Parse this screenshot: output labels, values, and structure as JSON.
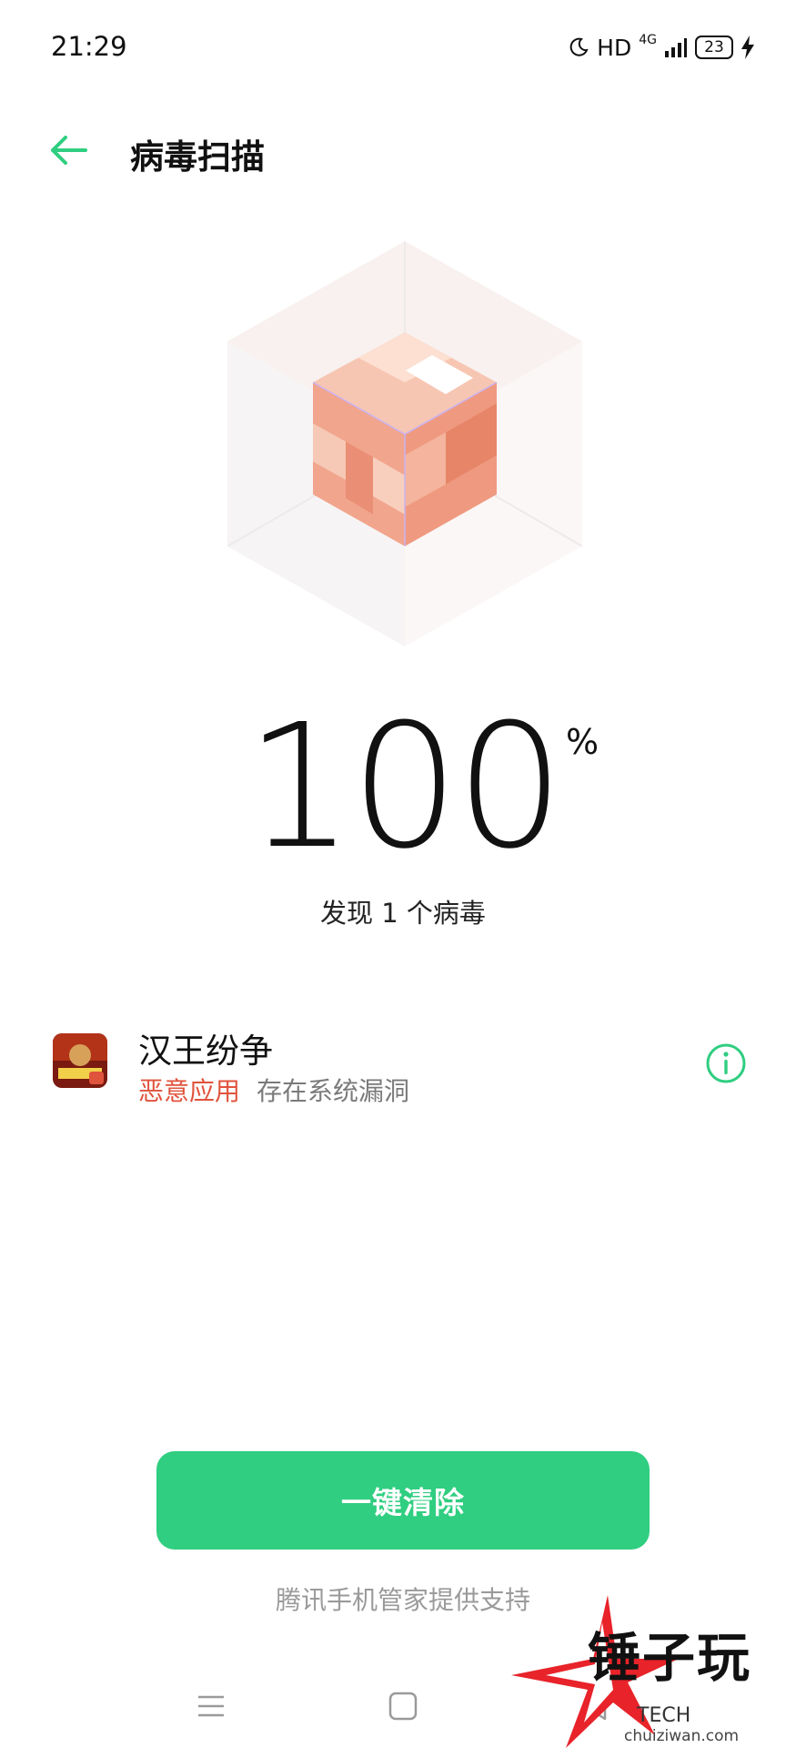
{
  "status_bar": {
    "time": "21:29",
    "hd": "HD",
    "network": "4G",
    "battery": "23"
  },
  "header": {
    "title": "病毒扫描"
  },
  "scan": {
    "percent": "100",
    "percent_sign": "%",
    "result_text": "发现 1 个病毒"
  },
  "threat": {
    "app_name": "汉王纷争",
    "threat_type": "恶意应用",
    "threat_desc": "存在系统漏洞"
  },
  "actions": {
    "clean_label": "一键清除"
  },
  "footer": {
    "support_text": "腾讯手机管家提供支持"
  },
  "watermark": {
    "brand": "锤子玩",
    "sub": "TECH",
    "url": "chuiziwan.com"
  },
  "colors": {
    "accent_green": "#2fce80",
    "warning_red": "#e0533c",
    "cube_orange": "#ee9a80"
  },
  "icons": {
    "back": "arrow-left-icon",
    "info": "info-icon",
    "moon": "moon-icon",
    "signal": "signal-icon",
    "charging": "bolt-icon",
    "nav_menu": "menu-icon",
    "nav_home": "home-square-icon",
    "nav_back": "back-triangle-icon"
  }
}
